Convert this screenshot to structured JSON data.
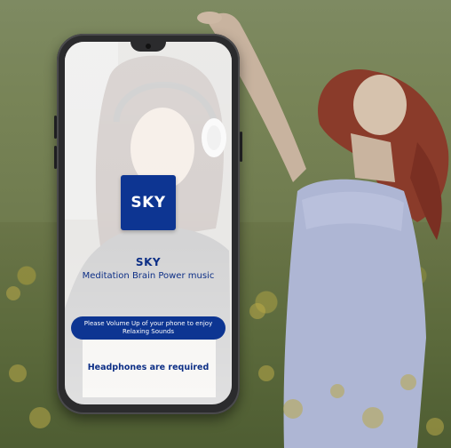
{
  "app": {
    "logo_text": "SKY",
    "name": "SKY",
    "tagline": "Meditation Brain Power music",
    "volume_notice": "Please Volume Up of your phone to enjoy Relaxing Sounds",
    "headphones_notice": "Headphones are required"
  },
  "colors": {
    "brand_blue": "#0d3592",
    "text_blue": "#0d2f86",
    "background_overlay": "#6f7a56"
  },
  "icons": {
    "camera": "front-camera-icon"
  }
}
